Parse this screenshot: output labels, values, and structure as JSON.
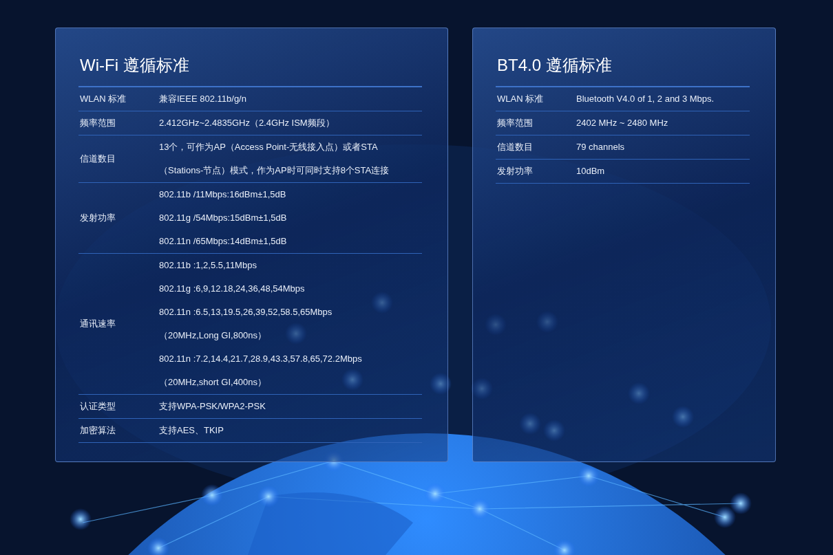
{
  "panels": [
    {
      "title": "Wi-Fi 遵循标准",
      "rows": [
        {
          "label": "WLAN 标准",
          "values": [
            "兼容IEEE 802.11b/g/n"
          ]
        },
        {
          "label": "频率范围",
          "values": [
            "2.412GHz~2.4835GHz（2.4GHz ISM频段）"
          ]
        },
        {
          "label": "信道数目",
          "values": [
            "13个，可作为AP（Access Point-无线接入点）或者STA",
            "（Stations-节点）模式，作为AP时可同时支持8个STA连接"
          ]
        },
        {
          "label": "发射功率",
          "values": [
            "802.11b /11Mbps:16dBm±1,5dB",
            "802.11g /54Mbps:15dBm±1,5dB",
            "802.11n /65Mbps:14dBm±1,5dB"
          ]
        },
        {
          "label": "通讯速率",
          "values": [
            "802.11b :1,2,5.5,11Mbps",
            "802.11g :6,9,12.18,24,36,48,54Mbps",
            "802.11n :6.5,13,19.5,26,39,52,58.5,65Mbps",
            "（20MHz,Long GI,800ns）",
            "802.11n :7.2,14.4,21.7,28.9,43.3,57.8,65,72.2Mbps",
            "（20MHz,short GI,400ns）"
          ]
        },
        {
          "label": "认证类型",
          "values": [
            "支持WPA-PSK/WPA2-PSK"
          ]
        },
        {
          "label": "加密算法",
          "values": [
            "支持AES、TKIP"
          ]
        }
      ]
    },
    {
      "title": "BT4.0 遵循标准",
      "rows": [
        {
          "label": "WLAN 标准",
          "values": [
            "Bluetooth V4.0 of 1, 2 and 3 Mbps."
          ]
        },
        {
          "label": "频率范围",
          "values": [
            "2402 MHz ~ 2480 MHz"
          ]
        },
        {
          "label": "信道数目",
          "values": [
            "79 channels"
          ]
        },
        {
          "label": "发射功率",
          "values": [
            "10dBm"
          ]
        }
      ]
    }
  ]
}
